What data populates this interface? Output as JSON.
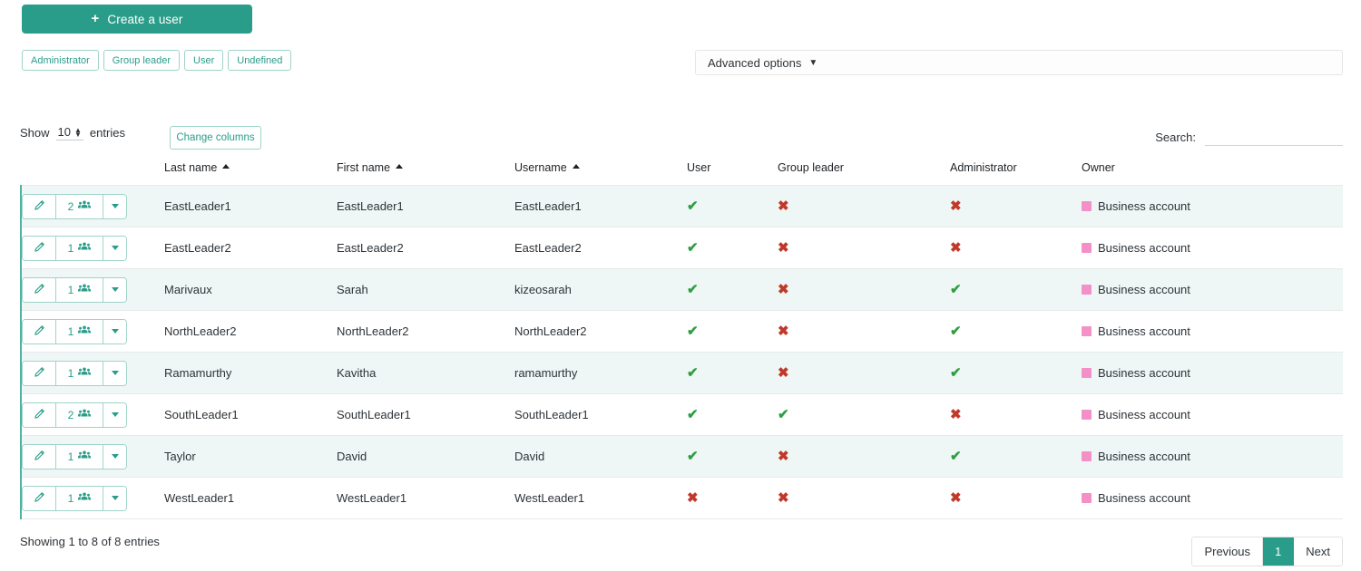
{
  "toolbar": {
    "create_user_label": "Create a user",
    "create_user_icon": "plus-icon",
    "accent_color": "#2a9d8a"
  },
  "role_filters": [
    {
      "label": "Administrator"
    },
    {
      "label": "Group leader"
    },
    {
      "label": "User"
    },
    {
      "label": "Undefined"
    }
  ],
  "advanced_options": {
    "label": "Advanced options",
    "caret_icon": "chevron-down-icon"
  },
  "length_menu": {
    "prefix": "Show",
    "value": "10",
    "suffix": "entries"
  },
  "change_columns": {
    "label": "Change columns"
  },
  "search": {
    "label": "Search:",
    "value": "",
    "placeholder": ""
  },
  "table": {
    "columns": [
      {
        "key": "actions",
        "label": "",
        "sorted": false
      },
      {
        "key": "last",
        "label": "Last name",
        "sorted": true
      },
      {
        "key": "first",
        "label": "First name",
        "sorted": true
      },
      {
        "key": "username",
        "label": "Username",
        "sorted": true
      },
      {
        "key": "user",
        "label": "User",
        "sorted": false
      },
      {
        "key": "group",
        "label": "Group leader",
        "sorted": false
      },
      {
        "key": "admin",
        "label": "Administrator",
        "sorted": false
      },
      {
        "key": "owner",
        "label": "Owner",
        "sorted": false
      }
    ],
    "icons": {
      "edit": "pencil-icon",
      "groups": "users-group-icon",
      "caret": "caret-down-icon",
      "yes": "check-icon",
      "no": "cross-icon"
    },
    "marks": {
      "yes": "✔",
      "no": "✖"
    },
    "owner_swatch_color": "#f490c8",
    "rows": [
      {
        "count": "2",
        "last": "EastLeader1",
        "first": "EastLeader1",
        "username": "EastLeader1",
        "user": true,
        "group": false,
        "admin": false,
        "owner": "Business account"
      },
      {
        "count": "1",
        "last": "EastLeader2",
        "first": "EastLeader2",
        "username": "EastLeader2",
        "user": true,
        "group": false,
        "admin": false,
        "owner": "Business account"
      },
      {
        "count": "1",
        "last": "Marivaux",
        "first": "Sarah",
        "username": "kizeosarah",
        "user": true,
        "group": false,
        "admin": true,
        "owner": "Business account"
      },
      {
        "count": "1",
        "last": "NorthLeader2",
        "first": "NorthLeader2",
        "username": "NorthLeader2",
        "user": true,
        "group": false,
        "admin": true,
        "owner": "Business account"
      },
      {
        "count": "1",
        "last": "Ramamurthy",
        "first": "Kavitha",
        "username": "ramamurthy",
        "user": true,
        "group": false,
        "admin": true,
        "owner": "Business account"
      },
      {
        "count": "2",
        "last": "SouthLeader1",
        "first": "SouthLeader1",
        "username": "SouthLeader1",
        "user": true,
        "group": true,
        "admin": false,
        "owner": "Business account"
      },
      {
        "count": "1",
        "last": "Taylor",
        "first": "David",
        "username": "David",
        "user": true,
        "group": false,
        "admin": true,
        "owner": "Business account"
      },
      {
        "count": "1",
        "last": "WestLeader1",
        "first": "WestLeader1",
        "username": "WestLeader1",
        "user": false,
        "group": false,
        "admin": false,
        "owner": "Business account"
      }
    ]
  },
  "footer": {
    "info": "Showing 1 to 8 of 8 entries",
    "previous": "Previous",
    "pages": [
      "1"
    ],
    "next": "Next"
  }
}
